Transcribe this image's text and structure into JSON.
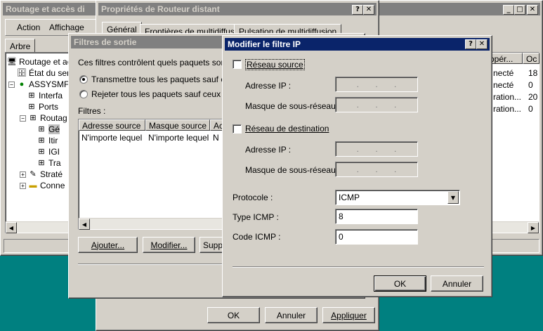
{
  "main_window": {
    "title": "Routage et accès di",
    "menu": [
      "Action",
      "Affichage"
    ],
    "tree_tab": "Arbre",
    "tree": [
      "Routage et accè",
      "État du ser",
      "ASSYSMFV",
      "Interfa",
      "Ports",
      "Routag",
      "Gé",
      "Itir",
      "IGI",
      "Tra",
      "Straté",
      "Conne"
    ],
    "right_list": {
      "columns": [
        "opér...",
        "Oc"
      ],
      "rows": [
        [
          "necté",
          "18"
        ],
        [
          "necté",
          "0"
        ],
        [
          "ration...",
          "20"
        ],
        [
          "ration...",
          "0"
        ]
      ]
    }
  },
  "props_window": {
    "title": "Propriétés de Routeur distant",
    "tabs": [
      "Général",
      "Frontières de multidiffusion",
      "Pulsation de multidiffusion"
    ],
    "buttons": {
      "ok": "OK",
      "cancel": "Annuler",
      "apply": "Appliquer"
    }
  },
  "output_filters": {
    "title": "Filtres de sortie",
    "description": "Ces filtres contrôlent quels paquets sont reç",
    "option_forward": "Transmettre tous les paquets sauf ceux",
    "option_reject": "Rejeter tous les paquets sauf ceux qui r",
    "filters_label": "Filtres :",
    "columns": [
      "Adresse source",
      "Masque source",
      "Ac"
    ],
    "rows": [
      [
        "N'importe lequel",
        "N'importe lequel",
        "N"
      ]
    ],
    "buttons": {
      "add": "Ajouter...",
      "modify": "Modifier...",
      "delete": "Suppr"
    }
  },
  "ip_filter": {
    "title": "Modifier le filtre IP",
    "source_network": "Réseau source",
    "dest_network": "Réseau de destination",
    "ip_address": "Adresse IP :",
    "subnet_mask": "Masque de sous-réseau :",
    "protocol_label": "Protocole :",
    "protocol_value": "ICMP",
    "icmp_type_label": "Type ICMP :",
    "icmp_type_value": "8",
    "icmp_code_label": "Code ICMP :",
    "icmp_code_value": "0",
    "buttons": {
      "ok": "OK",
      "cancel": "Annuler"
    }
  }
}
